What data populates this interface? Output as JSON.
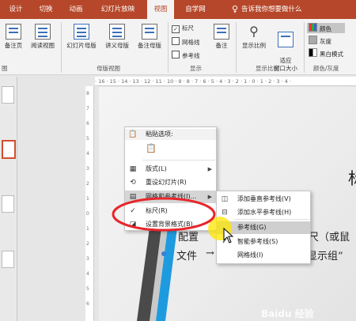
{
  "tabs": [
    "设计",
    "切换",
    "动画",
    "幻灯片放映",
    "视图",
    "自学网"
  ],
  "tell_me": "告诉我你想要做什么",
  "ribbon": {
    "views": {
      "notes_page": "备注页",
      "reading_view": "阅读视图"
    },
    "master": {
      "slide_master": "幻灯片母版",
      "handout_master": "讲义母版",
      "notes_master": "备注母版",
      "group_label": "母版视图"
    },
    "show": {
      "ruler": "标尺",
      "gridlines": "网格线",
      "guides": "参考线",
      "group_label": "显示"
    },
    "notes": "备注",
    "zoom": {
      "zoom": "显示比例",
      "fit_window": "适应\n窗口大小",
      "group_label": "显示比例"
    },
    "color": {
      "color": "颜色",
      "grayscale": "灰度",
      "black_white": "黑白模式",
      "group_label": "颜色/灰度"
    },
    "left_group_label": "图"
  },
  "ruler_text": "· 16 · 15 · 14 · 13 · 12 · 11 · 10 · 9 · 8 · 7 · 6 · 5 · 4 · 3 · 2 · 1 · 0 · 1 · 2 · 3 · 4 ·",
  "vruler": [
    "8",
    "7",
    "6",
    "5",
    "4",
    "3",
    "2",
    "1",
    "0",
    "1",
    "2",
    "3",
    "4",
    "5",
    "6"
  ],
  "slide": {
    "title_partial": "标",
    "line1_left": "配置",
    "line1_right": "尺（或鼠",
    "line2_left": "文件",
    "line2_arrow": "→",
    "line2_right": "显示组”"
  },
  "context_menu": {
    "paste_options": "粘贴选项:",
    "layout": "版式(L)",
    "reset_slide": "重设幻灯片(R)",
    "grid_guides": "网格和参考线(I)...",
    "ruler": "标尺(R)",
    "format_background": "设置背景格式(B)..."
  },
  "submenu": {
    "add_vertical_guide": "添加垂直参考线(V)",
    "add_horizontal_guide": "添加水平参考线(H)",
    "guides": "参考线(G)",
    "smart_guides": "智能参考线(S)",
    "gridlines": "网格线(I)"
  },
  "watermark": "Baidu 经验",
  "colors": {
    "accent": "#b7472a",
    "annotation": "#e8262b",
    "highlight": "#ffe600"
  }
}
